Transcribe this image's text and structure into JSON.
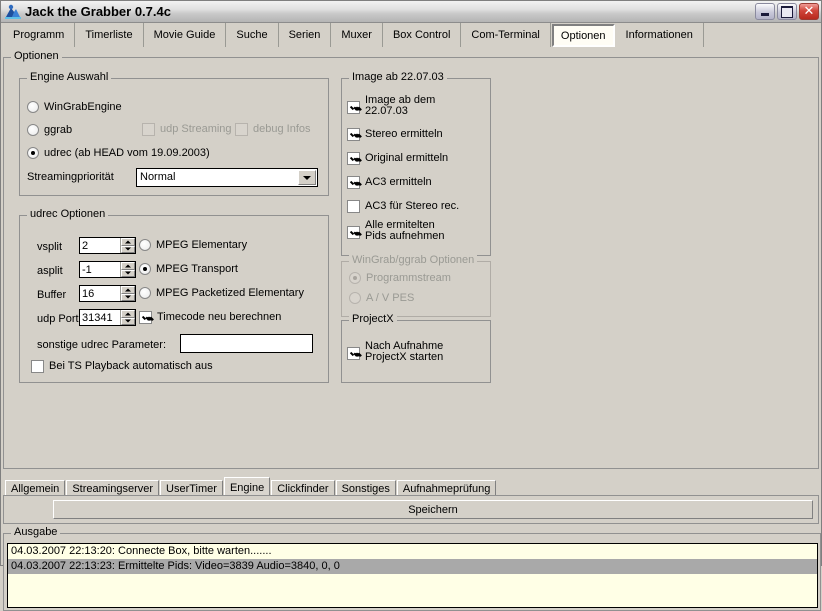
{
  "window": {
    "title": "Jack the Grabber 0.7.4c",
    "icon": "app-icon",
    "minimize_label": "Minimieren",
    "maximize_label": "Maximieren",
    "close_label": "Schließen"
  },
  "top_tabs": [
    {
      "label": "Programm",
      "selected": false
    },
    {
      "label": "Timerliste",
      "selected": false
    },
    {
      "label": "Movie Guide",
      "selected": false
    },
    {
      "label": "Suche",
      "selected": false
    },
    {
      "label": "Serien",
      "selected": false
    },
    {
      "label": "Muxer",
      "selected": false
    },
    {
      "label": "Box Control",
      "selected": false
    },
    {
      "label": "Com-Terminal",
      "selected": false
    },
    {
      "label": "Optionen",
      "selected": true
    },
    {
      "label": "Informationen",
      "selected": false
    }
  ],
  "options_group": {
    "legend": "Optionen"
  },
  "engine_group": {
    "legend": "Engine Auswahl",
    "radios": [
      {
        "label": "WinGrabEngine",
        "checked": false,
        "disabled": false
      },
      {
        "label": "ggrab",
        "checked": false,
        "disabled": false
      },
      {
        "label": "udrec (ab HEAD vom 19.09.2003)",
        "checked": true,
        "disabled": false
      }
    ],
    "checkboxes": [
      {
        "label": "udp Streaming",
        "checked": false,
        "disabled": true
      },
      {
        "label": "debug Infos",
        "checked": false,
        "disabled": true
      }
    ],
    "priority_label": "Streamingpriorität",
    "priority_value": "Normal",
    "priority_options": [
      "Normal"
    ]
  },
  "udrec_group": {
    "legend": "udrec Optionen",
    "fields": [
      {
        "label": "vsplit",
        "value": "2"
      },
      {
        "label": "asplit",
        "value": "-1"
      },
      {
        "label": "Buffer",
        "value": "16"
      },
      {
        "label": "udp Port",
        "value": "31341"
      }
    ],
    "radios": [
      {
        "label": "MPEG Elementary",
        "checked": false
      },
      {
        "label": "MPEG Transport",
        "checked": true
      },
      {
        "label": "MPEG Packetized Elementary",
        "checked": false
      }
    ],
    "timecode": {
      "label": "Timecode neu berechnen",
      "checked": true
    },
    "param_label": "sonstige udrec Parameter:",
    "param_value": "",
    "param_placeholder": "",
    "ts_playback": {
      "label": "Bei TS Playback automatisch aus",
      "checked": false
    }
  },
  "image_group": {
    "legend": "Image ab 22.07.03",
    "checkboxes": [
      {
        "label": "Image ab dem\n22.07.03",
        "line1": "Image ab dem",
        "line2": "22.07.03",
        "checked": true
      },
      {
        "label": "Stereo ermitteln",
        "line1": "Stereo ermitteln",
        "line2": "",
        "checked": true
      },
      {
        "label": "Original ermitteln",
        "line1": "Original ermitteln",
        "line2": "",
        "checked": true
      },
      {
        "label": "AC3 ermitteln",
        "line1": "AC3 ermitteln",
        "line2": "",
        "checked": true
      },
      {
        "label": "AC3 für Stereo rec.",
        "line1": "AC3 für Stereo rec.",
        "line2": "",
        "checked": false
      },
      {
        "label": "Alle ermitelten\nPids aufnehmen",
        "line1": "Alle ermitelten",
        "line2": "Pids aufnehmen",
        "checked": true
      }
    ]
  },
  "wingrab_group": {
    "legend": "WinGrab/ggrab Optionen",
    "disabled": true,
    "radios": [
      {
        "label": "Programmstream",
        "checked": true
      },
      {
        "label": "A / V PES",
        "checked": false
      }
    ]
  },
  "projectx_group": {
    "legend": "ProjectX",
    "checkbox": {
      "line1": "Nach Aufnahme",
      "line2": "ProjectX starten",
      "checked": true
    }
  },
  "bottom_tabs": [
    {
      "label": "Allgemein",
      "selected": false
    },
    {
      "label": "Streamingserver",
      "selected": false
    },
    {
      "label": "UserTimer",
      "selected": false
    },
    {
      "label": "Engine",
      "selected": true
    },
    {
      "label": "Clickfinder",
      "selected": false
    },
    {
      "label": "Sonstiges",
      "selected": false
    },
    {
      "label": "Aufnahmeprüfung",
      "selected": false
    }
  ],
  "save_button": {
    "label": "Speichern"
  },
  "ausgabe": {
    "legend": "Ausgabe",
    "rows": [
      {
        "text": "04.03.2007 22:13:20: Connecte Box, bitte warten.......",
        "selected": false
      },
      {
        "text": "04.03.2007 22:13:23: Ermittelte Pids: Video=3839 Audio=3840, 0, 0",
        "selected": true
      }
    ]
  },
  "colors": {
    "face": "#d4d0c8",
    "border": "#919191",
    "log_bg": "#ffffe6",
    "log_selected": "#a9a9a9",
    "close_button": "#b8291d"
  }
}
